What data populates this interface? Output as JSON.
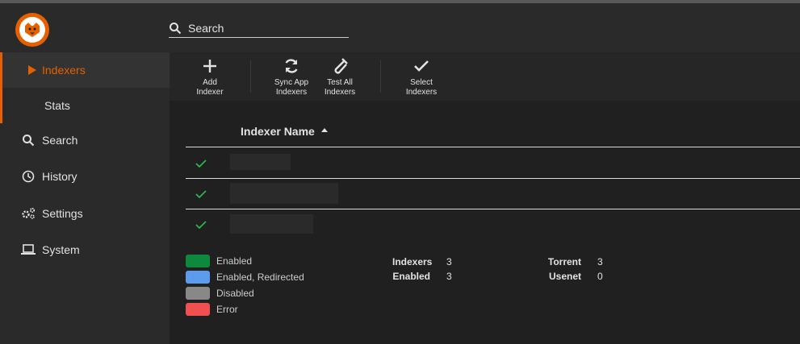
{
  "search": {
    "placeholder": "Search"
  },
  "sidebar": {
    "items": [
      {
        "label": "Indexers",
        "icon": "play-icon",
        "active": true
      },
      {
        "label": "Stats",
        "icon": "",
        "sub": true
      },
      {
        "label": "Search",
        "icon": "search-icon"
      },
      {
        "label": "History",
        "icon": "clock-icon"
      },
      {
        "label": "Settings",
        "icon": "gears-icon"
      },
      {
        "label": "System",
        "icon": "laptop-icon"
      }
    ]
  },
  "toolbar": {
    "add_indexer": "Add\nIndexer",
    "sync_app_indexers": "Sync App\nIndexers",
    "test_all_indexers": "Test All\nIndexers",
    "select_indexers": "Select\nIndexers"
  },
  "table": {
    "header": {
      "name": "Indexer Name",
      "sort": "ascending"
    },
    "rows": [
      {
        "status": "enabled",
        "name": ""
      },
      {
        "status": "enabled",
        "name": ""
      },
      {
        "status": "enabled",
        "name": ""
      }
    ]
  },
  "legend": {
    "items": [
      {
        "label": "Enabled",
        "color": "#0e883c"
      },
      {
        "label": "Enabled, Redirected",
        "color": "#5d9cec"
      },
      {
        "label": "Disabled",
        "color": "#888888"
      },
      {
        "label": "Error",
        "color": "#f05050"
      }
    ]
  },
  "stats": {
    "indexers_label": "Indexers",
    "indexers_value": "3",
    "enabled_label": "Enabled",
    "enabled_value": "3",
    "torrent_label": "Torrent",
    "torrent_value": "3",
    "usenet_label": "Usenet",
    "usenet_value": "0"
  },
  "colors": {
    "accent": "#e66000",
    "check": "#27c24c"
  }
}
